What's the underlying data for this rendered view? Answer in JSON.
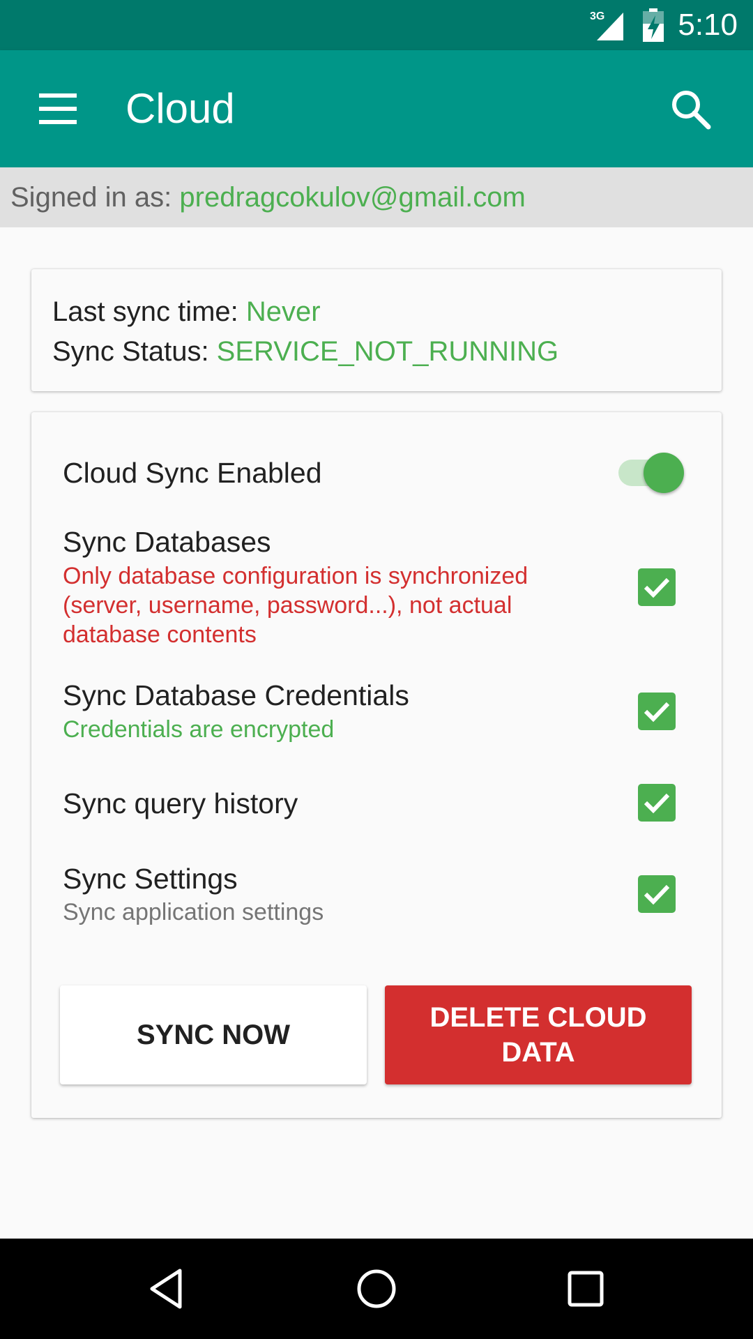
{
  "status_bar": {
    "network_label": "3G",
    "time": "5:10",
    "icons": [
      "signal-icon",
      "battery-charging-icon"
    ]
  },
  "app_bar": {
    "title": "Cloud",
    "icons": [
      "menu-icon",
      "search-icon"
    ],
    "color": "#009688"
  },
  "account": {
    "prefix": "Signed in as: ",
    "email": "predragcokulov@gmail.com"
  },
  "sync_info": {
    "last_sync_label": "Last sync time: ",
    "last_sync_value": "Never",
    "status_label": "Sync Status: ",
    "status_value": "SERVICE_NOT_RUNNING"
  },
  "settings": {
    "cloud_sync": {
      "label": "Cloud Sync Enabled",
      "enabled": true
    },
    "items": [
      {
        "title": "Sync Databases",
        "subtitle_lines": [
          "Only database configuration is synchronized",
          "(server, username, password...), not actual",
          "database contents"
        ],
        "subtitle_color": "#d32f2f",
        "checked": true
      },
      {
        "title": "Sync Database Credentials",
        "subtitle_lines": [
          "Credentials are encrypted"
        ],
        "subtitle_color": "#4caf50",
        "checked": true
      },
      {
        "title": "Sync query history",
        "subtitle_lines": [],
        "checked": true
      },
      {
        "title": "Sync Settings",
        "subtitle_lines": [
          "Sync application settings"
        ],
        "subtitle_color": "#757575",
        "checked": true
      }
    ]
  },
  "actions": {
    "sync_now": "SYNC NOW",
    "delete_line1": "DELETE CLOUD",
    "delete_line2": "DATA"
  },
  "colors": {
    "accent": "#4caf50",
    "danger": "#d32f2f",
    "status_bar": "#00796b"
  },
  "nav_bar": {
    "icons": [
      "back-icon",
      "home-icon",
      "recents-icon"
    ]
  }
}
